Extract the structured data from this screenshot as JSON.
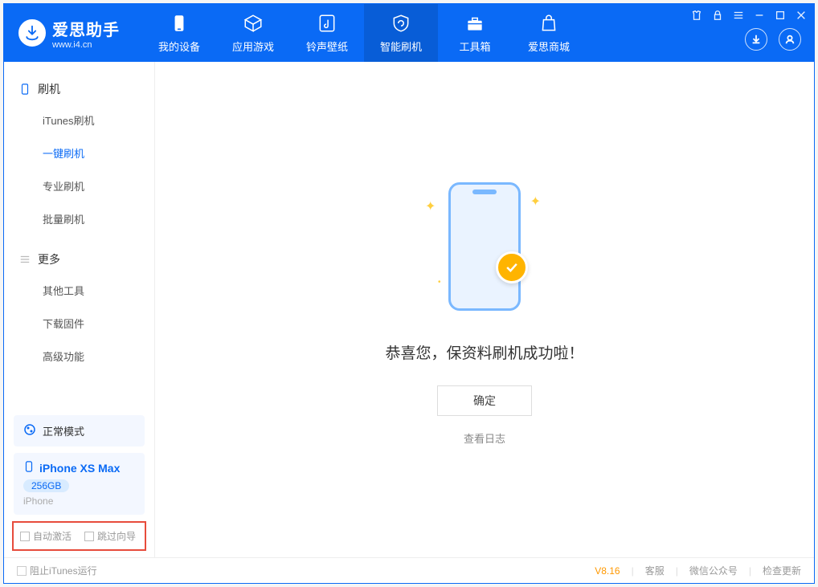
{
  "app": {
    "title": "爱思助手",
    "subtitle": "www.i4.cn"
  },
  "nav": {
    "items": [
      "我的设备",
      "应用游戏",
      "铃声壁纸",
      "智能刷机",
      "工具箱",
      "爱思商城"
    ],
    "active_index": 3
  },
  "sidebar": {
    "group1": {
      "label": "刷机",
      "items": [
        "iTunes刷机",
        "一键刷机",
        "专业刷机",
        "批量刷机"
      ],
      "active_index": 1
    },
    "group2": {
      "label": "更多",
      "items": [
        "其他工具",
        "下载固件",
        "高级功能"
      ]
    },
    "mode": {
      "label": "正常模式"
    },
    "device": {
      "name": "iPhone XS Max",
      "storage": "256GB",
      "type": "iPhone"
    },
    "checks": {
      "auto_activate": "自动激活",
      "skip_guide": "跳过向导"
    }
  },
  "main": {
    "success_text": "恭喜您，保资料刷机成功啦！",
    "ok_button": "确定",
    "view_log": "查看日志"
  },
  "status": {
    "block_itunes": "阻止iTunes运行",
    "version": "V8.16",
    "links": [
      "客服",
      "微信公众号",
      "检查更新"
    ]
  }
}
